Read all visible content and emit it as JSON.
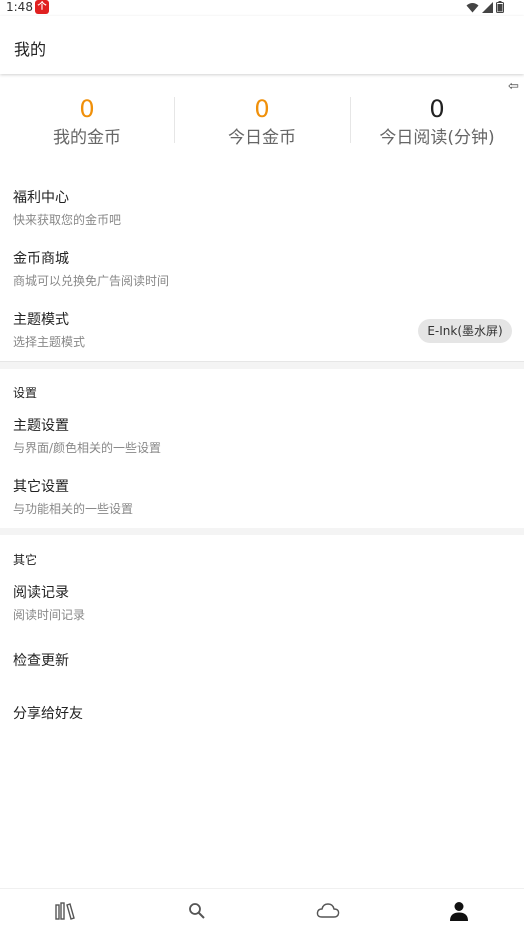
{
  "status_bar": {
    "time": "1:48",
    "notif_badge": "个",
    "icons": [
      "wifi-icon",
      "signal-icon",
      "battery-icon"
    ]
  },
  "header": {
    "title": "我的"
  },
  "stats": [
    {
      "value": "0",
      "label": "我的金币",
      "color": "#f0900a"
    },
    {
      "value": "0",
      "label": "今日金币",
      "color": "#f0900a"
    },
    {
      "value": "0",
      "label": "今日阅读(分钟)",
      "color": "#222222"
    }
  ],
  "menu_top": [
    {
      "title": "福利中心",
      "subtitle": "快来获取您的金币吧"
    },
    {
      "title": "金币商城",
      "subtitle": "商城可以兑换免广告阅读时间"
    },
    {
      "title": "主题模式",
      "subtitle": "选择主题模式",
      "chip": "E-Ink(墨水屏)"
    }
  ],
  "settings_section": {
    "title": "设置",
    "items": [
      {
        "title": "主题设置",
        "subtitle": "与界面/颜色相关的一些设置"
      },
      {
        "title": "其它设置",
        "subtitle": "与功能相关的一些设置"
      }
    ]
  },
  "other_section": {
    "title": "其它",
    "items": [
      {
        "title": "阅读记录",
        "subtitle": "阅读时间记录"
      },
      {
        "title": "检查更新"
      },
      {
        "title": "分享给好友"
      }
    ]
  },
  "bottom_nav": [
    {
      "icon": "bookshelf-icon",
      "active": false
    },
    {
      "icon": "search-icon",
      "active": false
    },
    {
      "icon": "cloud-icon",
      "active": false
    },
    {
      "icon": "profile-icon",
      "active": true
    }
  ],
  "colors": {
    "accent": "#f0900a",
    "section_gap": "#f4f4f4",
    "chip_bg": "#e5e5e5"
  }
}
